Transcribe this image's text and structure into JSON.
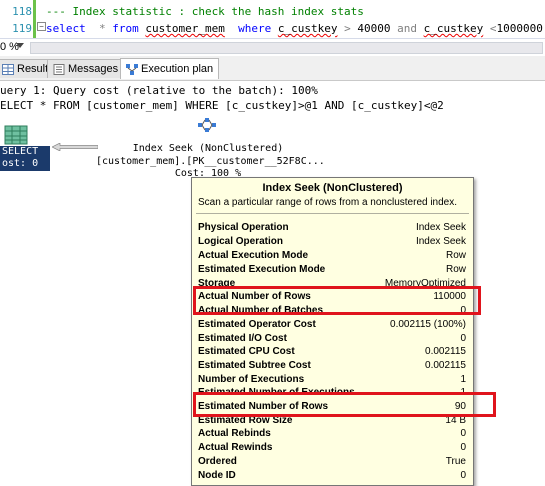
{
  "editor": {
    "lines": [
      {
        "number": "118",
        "text": "--- Index statistic : check the hash index stats"
      },
      {
        "number": "119",
        "kw_select": "select",
        "star": "*",
        "kw_from": "from",
        "table": "customer_mem",
        "kw_where": "where",
        "col1": "c_custkey",
        "op1": ">",
        "val1": "40000",
        "kw_and": "and",
        "col2": "c_custkey",
        "op2": "<",
        "val2": "1000000"
      }
    ],
    "collapse_glyph": "−"
  },
  "zoom": {
    "value": "0 %"
  },
  "tabs": [
    {
      "label": "Results",
      "icon": "grid-icon"
    },
    {
      "label": "Messages",
      "icon": "messages-icon"
    },
    {
      "label": "Execution plan",
      "icon": "plan-icon",
      "active": true
    }
  ],
  "query_header": {
    "line1": "uery 1: Query cost (relative to the batch): 100%",
    "line2": "ELECT * FROM [customer_mem] WHERE [c_custkey]>@1 AND [c_custkey]<@2"
  },
  "plan": {
    "select_node": {
      "label": "SELECT",
      "cost": "ost: 0 %"
    },
    "seek_node": {
      "name": "Index Seek (NonClustered)",
      "object": "[customer_mem].[PK__customer__52F8C...",
      "cost": "Cost: 100 %"
    }
  },
  "tooltip": {
    "title": "Index Seek (NonClustered)",
    "description": "Scan a particular range of rows from a nonclustered index.",
    "rows": [
      {
        "key": "Physical Operation",
        "value": "Index Seek"
      },
      {
        "key": "Logical Operation",
        "value": "Index Seek"
      },
      {
        "key": "Actual Execution Mode",
        "value": "Row"
      },
      {
        "key": "Estimated Execution Mode",
        "value": "Row"
      },
      {
        "key": "Storage",
        "value": "MemoryOptimized"
      },
      {
        "key": "Actual Number of Rows",
        "value": "110000"
      },
      {
        "key": "Actual Number of Batches",
        "value": "0"
      },
      {
        "key": "Estimated Operator Cost",
        "value": "0.002115 (100%)"
      },
      {
        "key": "Estimated I/O Cost",
        "value": "0"
      },
      {
        "key": "Estimated CPU Cost",
        "value": "0.002115"
      },
      {
        "key": "Estimated Subtree Cost",
        "value": "0.002115"
      },
      {
        "key": "Number of Executions",
        "value": "1"
      },
      {
        "key": "Estimated Number of Executions",
        "value": "1"
      },
      {
        "key": "Estimated Number of Rows",
        "value": "90"
      },
      {
        "key": "Estimated Row Size",
        "value": "14 B"
      },
      {
        "key": "Actual Rebinds",
        "value": "0"
      },
      {
        "key": "Actual Rewinds",
        "value": "0"
      },
      {
        "key": "Ordered",
        "value": "True"
      },
      {
        "key": "Node ID",
        "value": "0"
      }
    ]
  },
  "colors": {
    "highlight": "#e0141c",
    "tooltip_bg": "#ffffe1",
    "select_badge": "#1b3a6b",
    "keyword": "#0000ff",
    "comment": "#008000"
  }
}
